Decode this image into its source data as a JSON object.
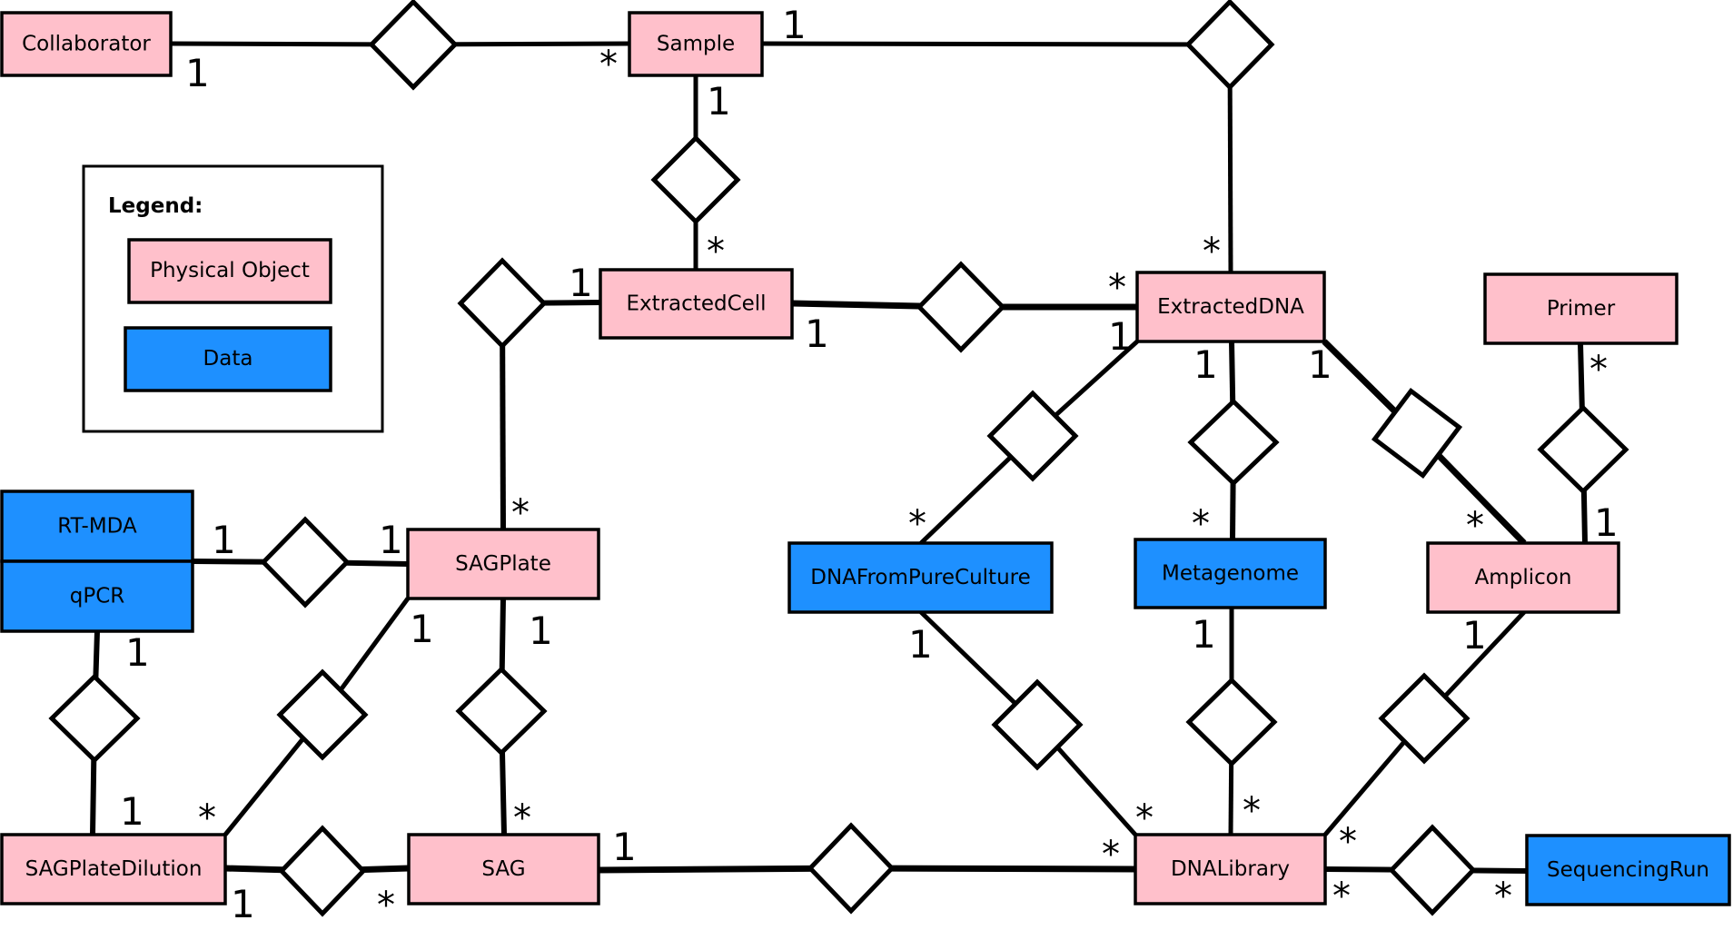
{
  "diagram": {
    "type": "entity-relationship",
    "colors": {
      "physical_object": "#ffc0cb",
      "data": "#1e90ff",
      "line": "#000000",
      "relationship_fill": "#ffffff"
    },
    "legend": {
      "title": "Legend:",
      "items": [
        {
          "kind": "physical",
          "label": "Physical Object"
        },
        {
          "kind": "data",
          "label": "Data"
        }
      ]
    },
    "entities": [
      {
        "id": "collaborator",
        "label": "Collaborator",
        "kind": "physical"
      },
      {
        "id": "sample",
        "label": "Sample",
        "kind": "physical"
      },
      {
        "id": "extracted_cell",
        "label": "ExtractedCell",
        "kind": "physical"
      },
      {
        "id": "extracted_dna",
        "label": "ExtractedDNA",
        "kind": "physical"
      },
      {
        "id": "primer",
        "label": "Primer",
        "kind": "physical"
      },
      {
        "id": "rt_mda",
        "label": "RT-MDA",
        "kind": "data"
      },
      {
        "id": "qpcr",
        "label": "qPCR",
        "kind": "data"
      },
      {
        "id": "sag_plate",
        "label": "SAGPlate",
        "kind": "physical"
      },
      {
        "id": "dna_from_pure_culture",
        "label": "DNAFromPureCulture",
        "kind": "data"
      },
      {
        "id": "metagenome",
        "label": "Metagenome",
        "kind": "data"
      },
      {
        "id": "amplicon",
        "label": "Amplicon",
        "kind": "physical"
      },
      {
        "id": "sag_plate_dilution",
        "label": "SAGPlateDilution",
        "kind": "physical"
      },
      {
        "id": "sag",
        "label": "SAG",
        "kind": "physical"
      },
      {
        "id": "dna_library",
        "label": "DNALibrary",
        "kind": "physical"
      },
      {
        "id": "sequencing_run",
        "label": "SequencingRun",
        "kind": "data"
      }
    ],
    "relationships": [
      {
        "id": "r_collab_sample",
        "from": "collaborator",
        "from_mult": "1",
        "to": "sample",
        "to_mult": "*"
      },
      {
        "id": "r_sample_dna",
        "from": "sample",
        "from_mult": "1",
        "to": "extracted_dna",
        "to_mult": "*"
      },
      {
        "id": "r_sample_cell",
        "from": "sample",
        "from_mult": "1",
        "to": "extracted_cell",
        "to_mult": "*"
      },
      {
        "id": "r_cell_dna",
        "from": "extracted_cell",
        "from_mult": "1",
        "to": "extracted_dna",
        "to_mult": "*"
      },
      {
        "id": "r_cell_plate",
        "from": "extracted_cell",
        "from_mult": "1",
        "to": "sag_plate",
        "to_mult": "*"
      },
      {
        "id": "r_dna_pure",
        "from": "extracted_dna",
        "from_mult": "1",
        "to": "dna_from_pure_culture",
        "to_mult": "*"
      },
      {
        "id": "r_dna_meta",
        "from": "extracted_dna",
        "from_mult": "1",
        "to": "metagenome",
        "to_mult": "*"
      },
      {
        "id": "r_dna_amp",
        "from": "extracted_dna",
        "from_mult": "1",
        "to": "amplicon",
        "to_mult": "*"
      },
      {
        "id": "r_primer_amp",
        "from": "primer",
        "from_mult": "*",
        "to": "amplicon",
        "to_mult": "1"
      },
      {
        "id": "r_qc_plate",
        "from": "rt_mda",
        "from_mult": "1",
        "to": "sag_plate",
        "to_mult": "1"
      },
      {
        "id": "r_qpcr_dil",
        "from": "qpcr",
        "from_mult": "1",
        "to": "sag_plate_dilution",
        "to_mult": "1"
      },
      {
        "id": "r_plate_dil",
        "from": "sag_plate",
        "from_mult": "1",
        "to": "sag_plate_dilution",
        "to_mult": "*"
      },
      {
        "id": "r_plate_sag",
        "from": "sag_plate",
        "from_mult": "1",
        "to": "sag",
        "to_mult": "*"
      },
      {
        "id": "r_dil_sag",
        "from": "sag_plate_dilution",
        "from_mult": "1",
        "to": "sag",
        "to_mult": "*"
      },
      {
        "id": "r_sag_lib",
        "from": "sag",
        "from_mult": "1",
        "to": "dna_library",
        "to_mult": "*"
      },
      {
        "id": "r_pure_lib",
        "from": "dna_from_pure_culture",
        "from_mult": "1",
        "to": "dna_library",
        "to_mult": "*"
      },
      {
        "id": "r_meta_lib",
        "from": "metagenome",
        "from_mult": "1",
        "to": "dna_library",
        "to_mult": "*"
      },
      {
        "id": "r_amp_lib",
        "from": "amplicon",
        "from_mult": "1",
        "to": "dna_library",
        "to_mult": "*"
      },
      {
        "id": "r_lib_run",
        "from": "dna_library",
        "from_mult": "*",
        "to": "sequencing_run",
        "to_mult": "*"
      }
    ]
  }
}
